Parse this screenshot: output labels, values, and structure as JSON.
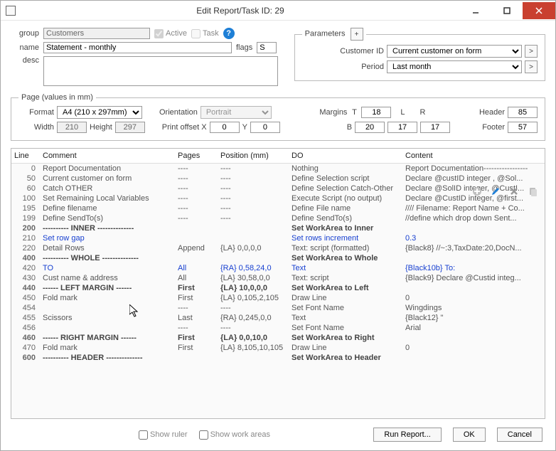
{
  "window": {
    "title": "Edit Report/Task    ID: 29"
  },
  "form": {
    "group_label": "group",
    "group_value": "Customers",
    "active_label": "Active",
    "task_label": "Task",
    "name_label": "name",
    "name_value": "Statement - monthly",
    "flags_label": "flags",
    "flags_value": "S",
    "desc_label": "desc",
    "desc_value": ""
  },
  "parameters": {
    "legend": "Parameters",
    "plus": "+",
    "rows": [
      {
        "label": "Customer ID",
        "value": "Current customer on form"
      },
      {
        "label": "Period",
        "value": "Last month"
      }
    ],
    "more": ">"
  },
  "page": {
    "legend": "Page (values in mm)",
    "format_label": "Format",
    "format_value": "A4 (210 x 297mm)",
    "orientation_label": "Orientation",
    "orientation_value": "Portrait",
    "margins_label": "Margins",
    "header_label": "Header",
    "footer_label": "Footer",
    "width_label": "Width",
    "height_label": "Height",
    "printoffset_label": "Print offset X",
    "width": "210",
    "height": "297",
    "offx": "0",
    "offy": "0",
    "mt": "18",
    "mb": "20",
    "ml": "17",
    "mr": "17",
    "header": "85",
    "footer": "57",
    "T": "T",
    "L": "L",
    "R": "R",
    "B": "B",
    "Y": "Y"
  },
  "table": {
    "headers": {
      "line": "Line",
      "comment": "Comment",
      "pages": "Pages",
      "position": "Position (mm)",
      "do": "DO",
      "content": "Content"
    },
    "rows": [
      {
        "line": "0",
        "comment": "Report Documentation",
        "pages": "----",
        "pos": "----",
        "do": "Nothing",
        "content": "Report Documentation-----------------",
        "bold": false
      },
      {
        "line": "50",
        "comment": "Current customer on form",
        "pages": "----",
        "pos": "----",
        "do": "Define Selection script",
        "content": "Declare @custID integer , @Sol...",
        "bold": false
      },
      {
        "line": "60",
        "comment": "Catch OTHER",
        "pages": "----",
        "pos": "----",
        "do": "Define Selection Catch-Other",
        "content": "Declare @SolID integer, @CustI...",
        "bold": false
      },
      {
        "line": "100",
        "comment": "Set Remaining Local Variables",
        "pages": "----",
        "pos": "----",
        "do": "Execute Script (no output)",
        "content": "Declare @CustID integer, @first...",
        "bold": false
      },
      {
        "line": "195",
        "comment": "Define filename",
        "pages": "----",
        "pos": "----",
        "do": "Define File name",
        "content": "//// Filename: Report Name + Co...",
        "bold": false
      },
      {
        "line": "199",
        "comment": "Define SendTo(s)",
        "pages": "----",
        "pos": "----",
        "do": "Define SendTo(s)",
        "content": "//define which drop down Sent...",
        "bold": false
      },
      {
        "line": "200",
        "comment": "---------- INNER --------------",
        "pages": "",
        "pos": "",
        "do": "Set WorkArea to Inner",
        "content": "",
        "bold": true
      },
      {
        "line": "210",
        "comment": "Set row gap",
        "pages": "",
        "pos": "",
        "do": "Set rows increment",
        "content": "0.3",
        "bold": false,
        "blue": true
      },
      {
        "line": "220",
        "comment": "Detail Rows",
        "pages": "Append",
        "pos": "{LA} 0,0,0,0",
        "do": "Text: script (formatted)",
        "content": "{Black8}  //~:3,TaxDate:20,DocN...",
        "bold": false
      },
      {
        "line": "400",
        "comment": "---------- WHOLE --------------",
        "pages": "",
        "pos": "",
        "do": "Set WorkArea to Whole",
        "content": "",
        "bold": true
      },
      {
        "line": "420",
        "comment": "TO",
        "pages": "All",
        "pos": "{RA} 0,58,24,0",
        "do": "Text",
        "content": "{Black10b}  To:",
        "bold": false,
        "blue": true
      },
      {
        "line": "430",
        "comment": "Cust name & address",
        "pages": "All",
        "pos": "{LA} 30,58,0,0",
        "do": "Text: script",
        "content": "{Black9}  Declare @Custid integ...",
        "bold": false
      },
      {
        "line": "440",
        "comment": "------ LEFT MARGIN ------",
        "pages": "First",
        "pos": "{LA} 10,0,0,0",
        "do": "Set WorkArea to Left",
        "content": "",
        "bold": true
      },
      {
        "line": "450",
        "comment": "Fold mark",
        "pages": "First",
        "pos": "{LA} 0,105,2,105",
        "do": "Draw Line",
        "content": "0",
        "bold": false
      },
      {
        "line": "454",
        "comment": "",
        "pages": "----",
        "pos": "----",
        "do": "Set Font Name",
        "content": "Wingdings",
        "bold": false
      },
      {
        "line": "455",
        "comment": "Scissors",
        "pages": "Last",
        "pos": "{RA} 0,245,0,0",
        "do": "Text",
        "content": "{Black12}  \"",
        "bold": false
      },
      {
        "line": "456",
        "comment": "",
        "pages": "----",
        "pos": "----",
        "do": "Set Font Name",
        "content": "Arial",
        "bold": false
      },
      {
        "line": "460",
        "comment": "------ RIGHT MARGIN ------",
        "pages": "First",
        "pos": "{LA} 0,0,10,0",
        "do": "Set WorkArea to Right",
        "content": "",
        "bold": true
      },
      {
        "line": "470",
        "comment": "Fold mark",
        "pages": "First",
        "pos": "{LA} 8,105,10,105",
        "do": "Draw Line",
        "content": "0",
        "bold": false
      },
      {
        "line": "600",
        "comment": "---------- HEADER --------------",
        "pages": "",
        "pos": "",
        "do": "Set WorkArea to Header",
        "content": "",
        "bold": true
      }
    ]
  },
  "bottom": {
    "show_ruler": "Show ruler",
    "show_work_areas": "Show work areas",
    "run": "Run Report...",
    "ok": "OK",
    "cancel": "Cancel"
  }
}
